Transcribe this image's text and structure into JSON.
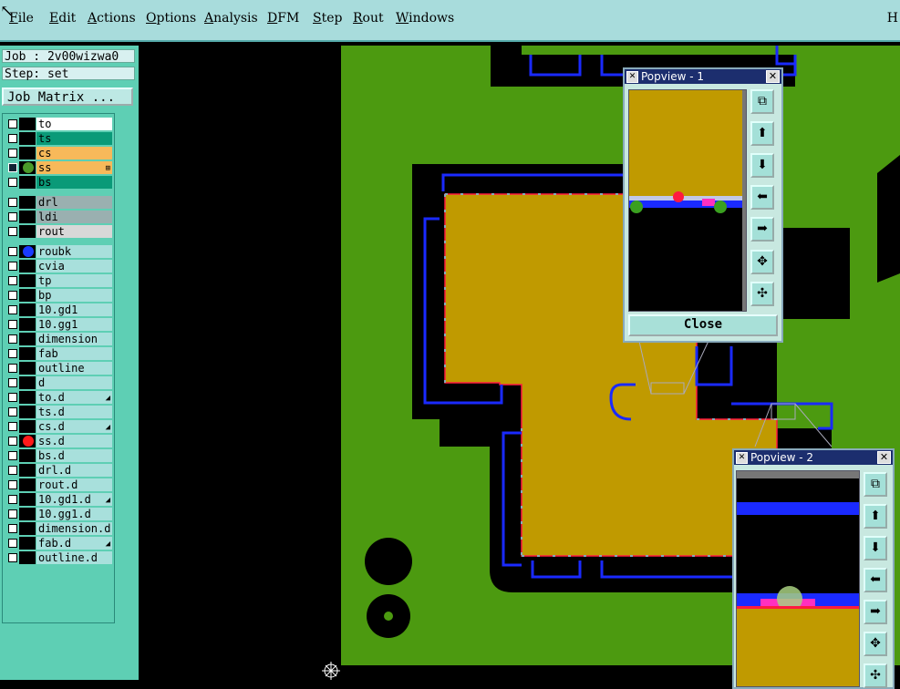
{
  "menubar": {
    "items": [
      {
        "key": "F",
        "rest": "ile"
      },
      {
        "key": "E",
        "rest": "dit"
      },
      {
        "key": "A",
        "rest": "ctions"
      },
      {
        "key": "O",
        "rest": "ptions"
      },
      {
        "key": "A",
        "rest": "nalysis"
      },
      {
        "key": "D",
        "rest": "FM"
      },
      {
        "key": "S",
        "rest": "tep"
      },
      {
        "key": "R",
        "rest": "out"
      },
      {
        "key": "W",
        "rest": "indows"
      }
    ],
    "right_label": "H"
  },
  "left": {
    "job": "Job : 2v00wizwa0",
    "step": "Step: set",
    "job_matrix": "Job Matrix ..."
  },
  "layers": [
    {
      "name": "to",
      "bg": "#ffffff",
      "dot": ""
    },
    {
      "name": "ts",
      "bg": "#0a9a78",
      "dot": ""
    },
    {
      "name": "cs",
      "bg": "#f7b95a",
      "dot": ""
    },
    {
      "name": "ss",
      "bg": "#f7b95a",
      "dot": "#4a9a2a",
      "active": true,
      "mark": "⊞"
    },
    {
      "name": "bs",
      "bg": "#0a9a78",
      "dot": ""
    },
    {
      "name": "drl",
      "bg": "#9ab0b0",
      "dot": ""
    },
    {
      "name": "ldi",
      "bg": "#9ab0b0",
      "dot": ""
    },
    {
      "name": "rout",
      "bg": "#d8d8d8",
      "dot": ""
    },
    {
      "name": "roubk",
      "bg": "#a8e0dc",
      "dot": "#1a3aff"
    },
    {
      "name": "cvia",
      "bg": "#a8e0dc",
      "dot": ""
    },
    {
      "name": "tp",
      "bg": "#a8e0dc",
      "dot": ""
    },
    {
      "name": "bp",
      "bg": "#a8e0dc",
      "dot": ""
    },
    {
      "name": "10.gd1",
      "bg": "#a8e0dc",
      "dot": ""
    },
    {
      "name": "10.gg1",
      "bg": "#a8e0dc",
      "dot": ""
    },
    {
      "name": "dimension",
      "bg": "#a8e0dc",
      "dot": ""
    },
    {
      "name": "fab",
      "bg": "#a8e0dc",
      "dot": ""
    },
    {
      "name": "outline",
      "bg": "#a8e0dc",
      "dot": ""
    },
    {
      "name": "d",
      "bg": "#a8e0dc",
      "dot": ""
    },
    {
      "name": "to.d",
      "bg": "#a8e0dc",
      "dot": "",
      "mark": "◢"
    },
    {
      "name": "ts.d",
      "bg": "#a8e0dc",
      "dot": ""
    },
    {
      "name": "cs.d",
      "bg": "#a8e0dc",
      "dot": "",
      "mark": "◢"
    },
    {
      "name": "ss.d",
      "bg": "#a8e0dc",
      "dot": "#ff1a1a"
    },
    {
      "name": "bs.d",
      "bg": "#a8e0dc",
      "dot": ""
    },
    {
      "name": "drl.d",
      "bg": "#a8e0dc",
      "dot": ""
    },
    {
      "name": "rout.d",
      "bg": "#a8e0dc",
      "dot": ""
    },
    {
      "name": "10.gd1.d",
      "bg": "#a8e0dc",
      "dot": "",
      "mark": "◢"
    },
    {
      "name": "10.gg1.d",
      "bg": "#a8e0dc",
      "dot": ""
    },
    {
      "name": "dimension.d",
      "bg": "#a8e0dc",
      "dot": ""
    },
    {
      "name": "fab.d",
      "bg": "#a8e0dc",
      "dot": "",
      "mark": "◢"
    },
    {
      "name": "outline.d",
      "bg": "#a8e0dc",
      "dot": ""
    }
  ],
  "popview1": {
    "title": "Popview - 1",
    "close_label": "Close"
  },
  "popview2": {
    "title": "Popview - 2"
  },
  "colors": {
    "board_green": "#4c9a10",
    "copper": "#c09a00",
    "outline_blue": "#1a2aff",
    "highlight_red": "#ff1a40"
  }
}
